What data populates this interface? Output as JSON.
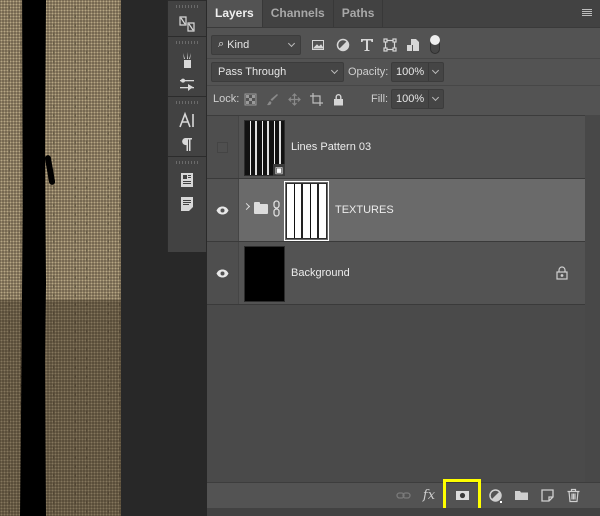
{
  "panel": {
    "tabs": [
      {
        "label": "Layers",
        "active": true
      },
      {
        "label": "Channels",
        "active": false
      },
      {
        "label": "Paths",
        "active": false
      }
    ],
    "menu_icon": "hamburger-menu-icon"
  },
  "filter": {
    "kind_label": "Kind",
    "search_icon": "search-icon",
    "icons": [
      "pixel-layer-filter-icon",
      "adjustment-layer-filter-icon",
      "type-layer-filter-icon",
      "shape-layer-filter-icon",
      "smart-object-filter-icon"
    ],
    "toggle": "filter-toggle"
  },
  "blend": {
    "mode": "Pass Through",
    "opacity_label": "Opacity:",
    "opacity_value": "100%"
  },
  "lock": {
    "label": "Lock:",
    "icons": [
      "lock-transparent-pixels-icon",
      "lock-image-pixels-icon",
      "lock-position-icon",
      "lock-artboard-icon",
      "lock-all-icon"
    ],
    "fill_label": "Fill:",
    "fill_value": "100%"
  },
  "layers": [
    {
      "name": "Lines Pattern 03",
      "visible": false,
      "type": "smart-object",
      "selected": false
    },
    {
      "name": "TEXTURES",
      "visible": true,
      "type": "group",
      "selected": true,
      "has_mask": true
    },
    {
      "name": "Background",
      "visible": true,
      "type": "background",
      "locked": true,
      "selected": false
    }
  ],
  "footer": {
    "buttons": [
      {
        "name": "link-layers-button",
        "icon": "link-icon"
      },
      {
        "name": "layer-style-button",
        "icon": "fx-icon",
        "label": "fx"
      },
      {
        "name": "add-mask-button",
        "icon": "layer-mask-icon",
        "highlighted": true,
        "highlight_color": "#ffff00"
      },
      {
        "name": "new-adjustment-layer-button",
        "icon": "adjustment-icon"
      },
      {
        "name": "new-group-button",
        "icon": "folder-icon"
      },
      {
        "name": "new-layer-button",
        "icon": "new-layer-icon"
      },
      {
        "name": "delete-layer-button",
        "icon": "trash-icon"
      }
    ]
  },
  "toolstrip": {
    "tools": [
      "artboard-tool-icon",
      "brushes-icon",
      "brush-settings-icon",
      "character-icon",
      "paragraph-icon",
      "character-styles-icon",
      "paragraph-styles-icon"
    ]
  }
}
